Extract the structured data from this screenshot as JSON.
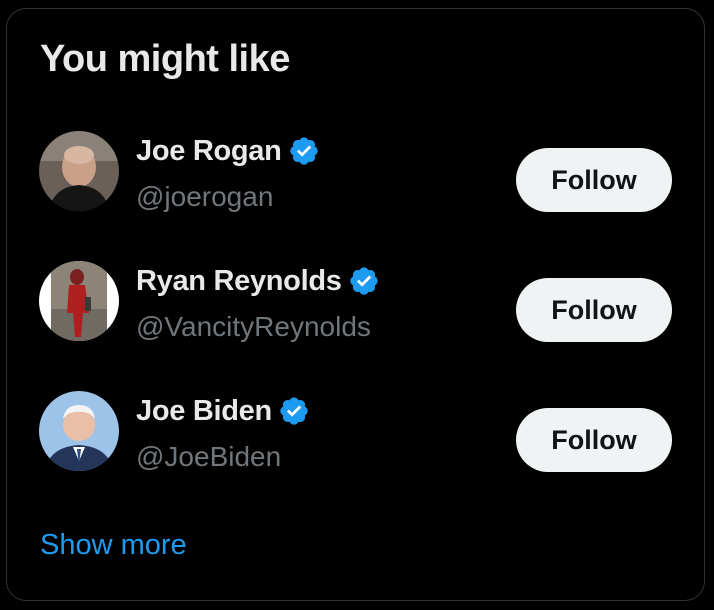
{
  "panel": {
    "title": "You might like",
    "show_more_label": "Show more"
  },
  "accounts": [
    {
      "name": "Joe Rogan",
      "handle": "@joerogan",
      "verified": true,
      "follow_label": "Follow"
    },
    {
      "name": "Ryan Reynolds",
      "handle": "@VancityReynolds",
      "verified": true,
      "follow_label": "Follow"
    },
    {
      "name": "Joe Biden",
      "handle": "@JoeBiden",
      "verified": true,
      "follow_label": "Follow"
    }
  ],
  "colors": {
    "background": "#000000",
    "primary_text": "#e7e9ea",
    "secondary_text": "#71767b",
    "accent": "#1d9bf0",
    "follow_button_bg": "#eff3f4"
  },
  "icons": {
    "verified": "verified-badge-icon"
  }
}
